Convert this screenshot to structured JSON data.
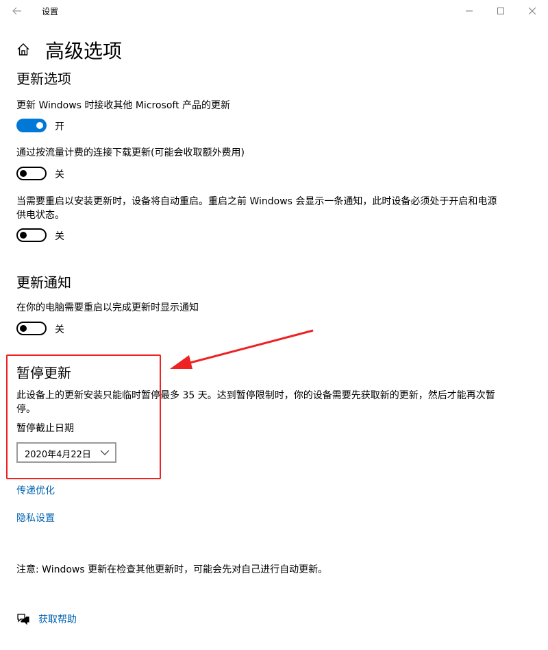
{
  "window": {
    "title": "设置"
  },
  "page": {
    "title": "高级选项"
  },
  "update_options": {
    "heading": "更新选项",
    "items": [
      {
        "label": "更新 Windows 时接收其他 Microsoft 产品的更新",
        "state": "开"
      },
      {
        "label": "通过按流量计费的连接下载更新(可能会收取额外费用)",
        "state": "关"
      },
      {
        "label_line1": "当需要重启以安装更新时，设备将自动重启。重启之前 Windows 会显示一条通知，此时设备必须处于开启和电源",
        "label_line2": "供电状态。",
        "state": "关"
      }
    ]
  },
  "update_notifications": {
    "heading": "更新通知",
    "label": "在你的电脑需要重启以完成更新时显示通知",
    "state": "关"
  },
  "pause_updates": {
    "heading": "暂停更新",
    "desc_line1": "此设备上的更新安装只能临时暂停最多 35 天。达到暂停限制时，你的设备需要先获取新的更新，然后才能再次暂",
    "desc_line2": "停。",
    "date_label": "暂停截止日期",
    "date_value": "2020年4月22日"
  },
  "links": {
    "delivery": "传递优化",
    "privacy": "隐私设置"
  },
  "note": "注意: Windows 更新在检查其他更新时，可能会先对自己进行自动更新。",
  "help": {
    "label": "获取帮助"
  },
  "colors": {
    "accent": "#0078d7",
    "link": "#0063b1",
    "annotation": "#ee2222"
  }
}
